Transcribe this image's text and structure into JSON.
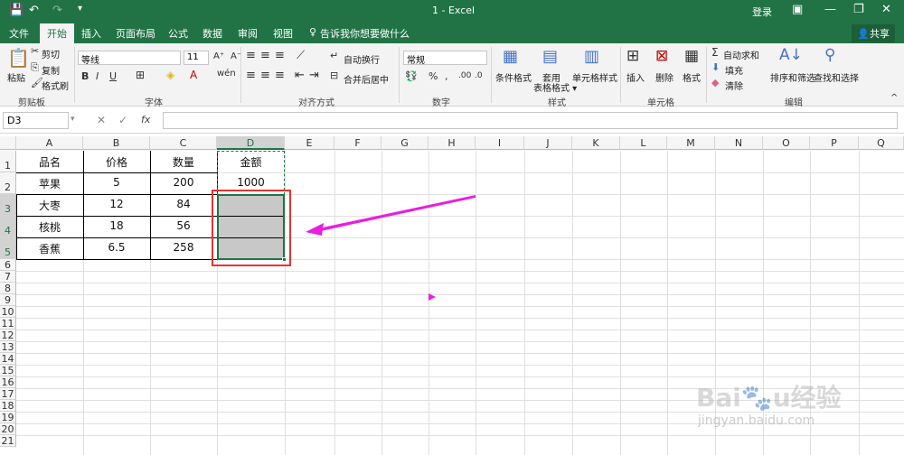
{
  "app": {
    "title": "1  -  Excel",
    "login": "登录"
  },
  "tabs": [
    "文件",
    "开始",
    "插入",
    "页面布局",
    "公式",
    "数据",
    "审阅",
    "视图"
  ],
  "tell_me": "告诉我你想要做什么",
  "share": "共享",
  "ribbon": {
    "paste": "粘贴",
    "cut": "剪切",
    "copy": "复制",
    "format_painter": "格式刷",
    "clipboard": "剪贴板",
    "font_name": "等线",
    "font_size": "11",
    "font_group": "字体",
    "wrap": "自动换行",
    "merge": "合并后居中",
    "align_group": "对齐方式",
    "number_format": "常规",
    "number_group": "数字",
    "cond_format": "条件格式",
    "table_format": "套用\n表格格式",
    "cell_style": "单元格样式",
    "style_group": "样式",
    "insert": "插入",
    "delete": "删除",
    "format": "格式",
    "cells_group": "单元格",
    "autosum": "自动求和",
    "fill": "填充",
    "clear": "清除",
    "sort": "排序和筛选",
    "find": "查找和选择",
    "edit_group": "编辑"
  },
  "formula_bar": {
    "name_box": "D3",
    "fx": "fx",
    "value": ""
  },
  "columns": [
    "A",
    "B",
    "C",
    "D",
    "E",
    "F",
    "G",
    "H",
    "I",
    "J",
    "K",
    "L",
    "M",
    "N",
    "O",
    "P",
    "Q"
  ],
  "rows": [
    "1",
    "2",
    "3",
    "4",
    "5",
    "6",
    "7",
    "8",
    "9",
    "10",
    "11",
    "12",
    "13",
    "14",
    "15",
    "16",
    "17",
    "18",
    "19",
    "20",
    "21"
  ],
  "table": [
    [
      "品名",
      "价格",
      "数量",
      "金额"
    ],
    [
      "苹果",
      "5",
      "200",
      "1000"
    ],
    [
      "大枣",
      "12",
      "84",
      ""
    ],
    [
      "核桃",
      "18",
      "56",
      ""
    ],
    [
      "香蕉",
      "6.5",
      "258",
      ""
    ]
  ],
  "watermark": "Baidu经验 jingyan.baidu.com",
  "colors": {
    "excel_green": "#217346",
    "highlight_red": "#e8322f",
    "arrow_magenta": "#e81ee0",
    "selection_fill": "#c8c8c8"
  }
}
